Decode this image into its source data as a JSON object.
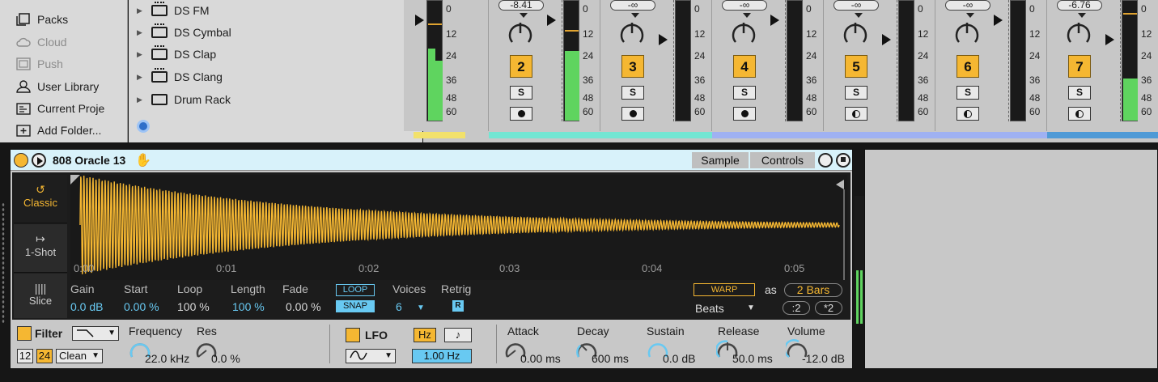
{
  "browser": {
    "places": [
      {
        "label": "Packs",
        "icon": "packs-icon",
        "dim": false
      },
      {
        "label": "Cloud",
        "icon": "cloud-icon",
        "dim": true
      },
      {
        "label": "Push",
        "icon": "push-icon",
        "dim": true
      },
      {
        "label": "User Library",
        "icon": "user-icon",
        "dim": false
      },
      {
        "label": "Current Proje",
        "icon": "folder-icon",
        "dim": false
      },
      {
        "label": "Add Folder...",
        "icon": "add-folder-icon",
        "dim": false
      }
    ],
    "items": [
      {
        "label": "DS FM"
      },
      {
        "label": "DS Cymbal"
      },
      {
        "label": "DS Clap"
      },
      {
        "label": "DS Clang"
      },
      {
        "label": "Drum Rack"
      }
    ]
  },
  "mixer": {
    "scale": [
      "0",
      "12",
      "24",
      "36",
      "48",
      "60"
    ],
    "strips": [
      {
        "volume": "-8.41",
        "number": "2",
        "arm": "dot",
        "color": "#73e6d3",
        "meter": 0.58,
        "peak": 0.76
      },
      {
        "volume": "-∞",
        "number": "3",
        "arm": "dot",
        "color": "#73e6d3",
        "meter": 0,
        "peak": 0
      },
      {
        "volume": "-∞",
        "number": "4",
        "arm": "dot",
        "color": "#9fb1f2",
        "meter": 0,
        "peak": 0
      },
      {
        "volume": "-∞",
        "number": "5",
        "arm": "half",
        "color": "#9fb1f2",
        "meter": 0,
        "peak": 0
      },
      {
        "volume": "-∞",
        "number": "6",
        "arm": "half",
        "color": "#9fb1f2",
        "meter": 0,
        "peak": 0
      },
      {
        "volume": "-6.76",
        "number": "7",
        "arm": "half",
        "color": "#4f9ad6",
        "meter": 0.35,
        "peak": 0.9
      }
    ],
    "solo_label": "S",
    "first_strip_color": "#f2e16b"
  },
  "device": {
    "name": "808 Oracle 13",
    "tabs": [
      "Sample",
      "Controls"
    ],
    "modes": [
      {
        "label": "Classic",
        "icon": "loop-arrow-icon",
        "glyph": "↺",
        "active": true
      },
      {
        "label": "1-Shot",
        "icon": "one-shot-icon",
        "glyph": "↦",
        "active": false
      },
      {
        "label": "Slice",
        "icon": "slice-icon",
        "glyph": "||||",
        "active": false
      }
    ],
    "time_labels": [
      "0:00",
      "0:01",
      "0:02",
      "0:03",
      "0:04",
      "0:05"
    ],
    "params": {
      "gain_label": "Gain",
      "gain": "0.0 dB",
      "start_label": "Start",
      "start": "0.00 %",
      "loop_label": "Loop",
      "loop": "100 %",
      "length_label": "Length",
      "length": "100 %",
      "fade_label": "Fade",
      "fade": "0.00 %",
      "loop_btn": "LOOP",
      "snap_btn": "SNAP",
      "voices_label": "Voices",
      "voices": "6",
      "retrig_label": "Retrig",
      "retrig": "R",
      "warp": "WARP",
      "as": "as",
      "bars": "2 Bars",
      "beats": "Beats",
      "half": ":2",
      "double": "*2"
    },
    "filter": {
      "label": "Filter",
      "slope_12": "12",
      "slope_24": "24",
      "type": "Clean",
      "frequency_label": "Frequency",
      "frequency": "22.0 kHz",
      "res_label": "Res",
      "res": "0.0 %"
    },
    "lfo": {
      "label": "LFO",
      "hz": "Hz",
      "note": "♪",
      "rate": "1.00",
      "rate_unit": "Hz"
    },
    "envelope": {
      "attack_label": "Attack",
      "attack": "0.00 ms",
      "decay_label": "Decay",
      "decay": "600 ms",
      "sustain_label": "Sustain",
      "sustain": "0.0 dB",
      "release_label": "Release",
      "release": "50.0 ms",
      "volume_label": "Volume",
      "volume": "-12.0 dB"
    },
    "colors": {
      "accent": "#f5b732",
      "blue": "#68c9f2",
      "title_bg": "#d8f2fa"
    }
  }
}
